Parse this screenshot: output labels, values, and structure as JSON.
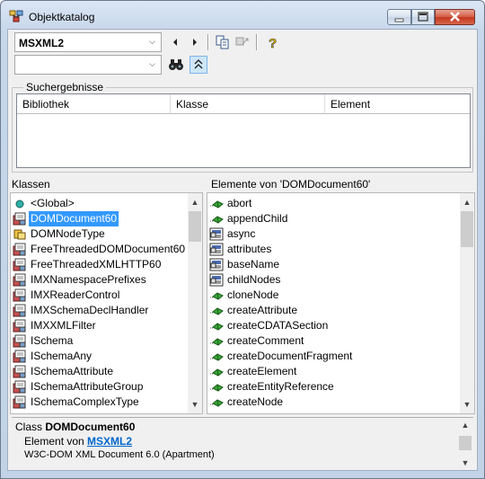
{
  "window": {
    "title": "Objektkatalog"
  },
  "toolbar": {
    "library_value": "MSXML2",
    "search_value": "",
    "back_icon": "arrow-left-icon",
    "forward_icon": "arrow-right-icon",
    "copy_icon": "copy-icon",
    "view_definition_icon": "view-definition-icon",
    "help_icon": "help-icon",
    "search_icon": "binoculars-icon",
    "toggle_icon": "collapse-up-icon"
  },
  "search": {
    "group_title": "Suchergebnisse",
    "columns": [
      "Bibliothek",
      "Klasse",
      "Element"
    ]
  },
  "classes": {
    "header": "Klassen",
    "items": [
      {
        "label": "<Global>",
        "icon": "globe-icon"
      },
      {
        "label": "DOMDocument60",
        "icon": "class-icon",
        "selected": true
      },
      {
        "label": "DOMNodeType",
        "icon": "enum-icon"
      },
      {
        "label": "FreeThreadedDOMDocument60",
        "icon": "class-icon"
      },
      {
        "label": "FreeThreadedXMLHTTP60",
        "icon": "class-icon"
      },
      {
        "label": "IMXNamespacePrefixes",
        "icon": "class-icon"
      },
      {
        "label": "IMXReaderControl",
        "icon": "class-icon"
      },
      {
        "label": "IMXSchemaDeclHandler",
        "icon": "class-icon"
      },
      {
        "label": "IMXXMLFilter",
        "icon": "class-icon"
      },
      {
        "label": "ISchema",
        "icon": "class-icon"
      },
      {
        "label": "ISchemaAny",
        "icon": "class-icon"
      },
      {
        "label": "ISchemaAttribute",
        "icon": "class-icon"
      },
      {
        "label": "ISchemaAttributeGroup",
        "icon": "class-icon"
      },
      {
        "label": "ISchemaComplexType",
        "icon": "class-icon"
      }
    ]
  },
  "members": {
    "header": "Elemente von 'DOMDocument60'",
    "items": [
      {
        "label": "abort",
        "icon": "method-icon"
      },
      {
        "label": "appendChild",
        "icon": "method-icon"
      },
      {
        "label": "async",
        "icon": "property-icon"
      },
      {
        "label": "attributes",
        "icon": "property-icon"
      },
      {
        "label": "baseName",
        "icon": "property-icon"
      },
      {
        "label": "childNodes",
        "icon": "property-icon"
      },
      {
        "label": "cloneNode",
        "icon": "method-icon"
      },
      {
        "label": "createAttribute",
        "icon": "method-icon"
      },
      {
        "label": "createCDATASection",
        "icon": "method-icon"
      },
      {
        "label": "createComment",
        "icon": "method-icon"
      },
      {
        "label": "createDocumentFragment",
        "icon": "method-icon"
      },
      {
        "label": "createElement",
        "icon": "method-icon"
      },
      {
        "label": "createEntityReference",
        "icon": "method-icon"
      },
      {
        "label": "createNode",
        "icon": "method-icon"
      }
    ]
  },
  "details": {
    "prefix": "Class",
    "name": "DOMDocument60",
    "member_of_label": "Element von",
    "library_link": "MSXML2",
    "description": "W3C-DOM XML Document 6.0 (Apartment)"
  }
}
